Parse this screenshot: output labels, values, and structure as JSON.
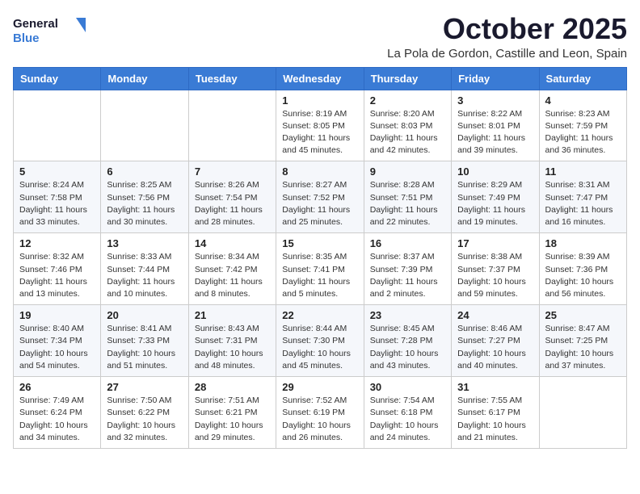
{
  "logo": {
    "line1": "General",
    "line2": "Blue"
  },
  "title": "October 2025",
  "location": "La Pola de Gordon, Castille and Leon, Spain",
  "days_of_week": [
    "Sunday",
    "Monday",
    "Tuesday",
    "Wednesday",
    "Thursday",
    "Friday",
    "Saturday"
  ],
  "weeks": [
    [
      {
        "day": "",
        "info": ""
      },
      {
        "day": "",
        "info": ""
      },
      {
        "day": "",
        "info": ""
      },
      {
        "day": "1",
        "info": "Sunrise: 8:19 AM\nSunset: 8:05 PM\nDaylight: 11 hours and 45 minutes."
      },
      {
        "day": "2",
        "info": "Sunrise: 8:20 AM\nSunset: 8:03 PM\nDaylight: 11 hours and 42 minutes."
      },
      {
        "day": "3",
        "info": "Sunrise: 8:22 AM\nSunset: 8:01 PM\nDaylight: 11 hours and 39 minutes."
      },
      {
        "day": "4",
        "info": "Sunrise: 8:23 AM\nSunset: 7:59 PM\nDaylight: 11 hours and 36 minutes."
      }
    ],
    [
      {
        "day": "5",
        "info": "Sunrise: 8:24 AM\nSunset: 7:58 PM\nDaylight: 11 hours and 33 minutes."
      },
      {
        "day": "6",
        "info": "Sunrise: 8:25 AM\nSunset: 7:56 PM\nDaylight: 11 hours and 30 minutes."
      },
      {
        "day": "7",
        "info": "Sunrise: 8:26 AM\nSunset: 7:54 PM\nDaylight: 11 hours and 28 minutes."
      },
      {
        "day": "8",
        "info": "Sunrise: 8:27 AM\nSunset: 7:52 PM\nDaylight: 11 hours and 25 minutes."
      },
      {
        "day": "9",
        "info": "Sunrise: 8:28 AM\nSunset: 7:51 PM\nDaylight: 11 hours and 22 minutes."
      },
      {
        "day": "10",
        "info": "Sunrise: 8:29 AM\nSunset: 7:49 PM\nDaylight: 11 hours and 19 minutes."
      },
      {
        "day": "11",
        "info": "Sunrise: 8:31 AM\nSunset: 7:47 PM\nDaylight: 11 hours and 16 minutes."
      }
    ],
    [
      {
        "day": "12",
        "info": "Sunrise: 8:32 AM\nSunset: 7:46 PM\nDaylight: 11 hours and 13 minutes."
      },
      {
        "day": "13",
        "info": "Sunrise: 8:33 AM\nSunset: 7:44 PM\nDaylight: 11 hours and 10 minutes."
      },
      {
        "day": "14",
        "info": "Sunrise: 8:34 AM\nSunset: 7:42 PM\nDaylight: 11 hours and 8 minutes."
      },
      {
        "day": "15",
        "info": "Sunrise: 8:35 AM\nSunset: 7:41 PM\nDaylight: 11 hours and 5 minutes."
      },
      {
        "day": "16",
        "info": "Sunrise: 8:37 AM\nSunset: 7:39 PM\nDaylight: 11 hours and 2 minutes."
      },
      {
        "day": "17",
        "info": "Sunrise: 8:38 AM\nSunset: 7:37 PM\nDaylight: 10 hours and 59 minutes."
      },
      {
        "day": "18",
        "info": "Sunrise: 8:39 AM\nSunset: 7:36 PM\nDaylight: 10 hours and 56 minutes."
      }
    ],
    [
      {
        "day": "19",
        "info": "Sunrise: 8:40 AM\nSunset: 7:34 PM\nDaylight: 10 hours and 54 minutes."
      },
      {
        "day": "20",
        "info": "Sunrise: 8:41 AM\nSunset: 7:33 PM\nDaylight: 10 hours and 51 minutes."
      },
      {
        "day": "21",
        "info": "Sunrise: 8:43 AM\nSunset: 7:31 PM\nDaylight: 10 hours and 48 minutes."
      },
      {
        "day": "22",
        "info": "Sunrise: 8:44 AM\nSunset: 7:30 PM\nDaylight: 10 hours and 45 minutes."
      },
      {
        "day": "23",
        "info": "Sunrise: 8:45 AM\nSunset: 7:28 PM\nDaylight: 10 hours and 43 minutes."
      },
      {
        "day": "24",
        "info": "Sunrise: 8:46 AM\nSunset: 7:27 PM\nDaylight: 10 hours and 40 minutes."
      },
      {
        "day": "25",
        "info": "Sunrise: 8:47 AM\nSunset: 7:25 PM\nDaylight: 10 hours and 37 minutes."
      }
    ],
    [
      {
        "day": "26",
        "info": "Sunrise: 7:49 AM\nSunset: 6:24 PM\nDaylight: 10 hours and 34 minutes."
      },
      {
        "day": "27",
        "info": "Sunrise: 7:50 AM\nSunset: 6:22 PM\nDaylight: 10 hours and 32 minutes."
      },
      {
        "day": "28",
        "info": "Sunrise: 7:51 AM\nSunset: 6:21 PM\nDaylight: 10 hours and 29 minutes."
      },
      {
        "day": "29",
        "info": "Sunrise: 7:52 AM\nSunset: 6:19 PM\nDaylight: 10 hours and 26 minutes."
      },
      {
        "day": "30",
        "info": "Sunrise: 7:54 AM\nSunset: 6:18 PM\nDaylight: 10 hours and 24 minutes."
      },
      {
        "day": "31",
        "info": "Sunrise: 7:55 AM\nSunset: 6:17 PM\nDaylight: 10 hours and 21 minutes."
      },
      {
        "day": "",
        "info": ""
      }
    ]
  ]
}
